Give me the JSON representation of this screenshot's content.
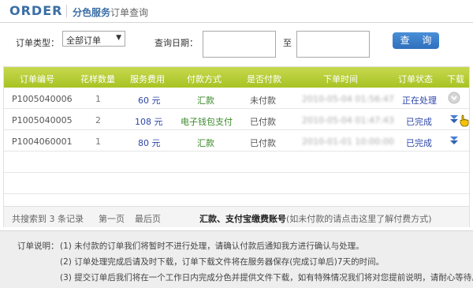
{
  "header": {
    "logo": "ORDER",
    "title_a": "分色服务",
    "title_b": "订单查询"
  },
  "search": {
    "order_type_label": "订单类型：",
    "order_type_value": "全部订单",
    "date_label": "查询日期：",
    "date_to_label": "至",
    "search_button": "查 询"
  },
  "table": {
    "headers": [
      "订单编号",
      "花样数量",
      "服务费用",
      "付款方式",
      "是否付款",
      "下单时间",
      "订单状态",
      "下载"
    ],
    "rows": [
      {
        "id": "P1005040006",
        "qty": "1",
        "fee": "60 元",
        "method": "汇款",
        "paid": "未付款",
        "time": "2010-05-04 01:56:47",
        "status": "正在处理",
        "download": "disabled-download-icon"
      },
      {
        "id": "P1005040005",
        "qty": "2",
        "fee": "108 元",
        "method": "电子钱包支付",
        "paid": "已付款",
        "time": "2010-05-04 01:47:43",
        "status": "已完成",
        "download": "download-icon"
      },
      {
        "id": "P1004060001",
        "qty": "1",
        "fee": "80 元",
        "method": "汇款",
        "paid": "已付款",
        "time": "2010-01-01 10:00:00",
        "status": "已完成",
        "download": "download-icon"
      }
    ]
  },
  "footer": {
    "count_prefix": "共搜索到",
    "count": "3",
    "count_suffix": "条记录",
    "first_page": "第一页",
    "last_page": "最后页",
    "account_link": "汇款、支付宝缴费账号",
    "account_hint": "(如未付款的请点击这里了解付费方式)"
  },
  "notes": {
    "title": "订单说明：",
    "items": [
      "(1) 未付款的订单我们将暂时不进行处理，请确认付款后通知我方进行确认与处理。",
      "(2) 订单处理完成后请及时下载，订单下载文件将在服务器保存(完成订单后)7天的时间。",
      "(3) 提交订单后我们将在一个工作日内完成分色并提供文件下载，如有特殊情况我们将对您提前说明，请耐心等待。"
    ]
  },
  "colors": {
    "accent": "#a8c324",
    "brand": "#3a6ea5",
    "link": "#2d46a8",
    "green_text": "#3c8a2a"
  }
}
